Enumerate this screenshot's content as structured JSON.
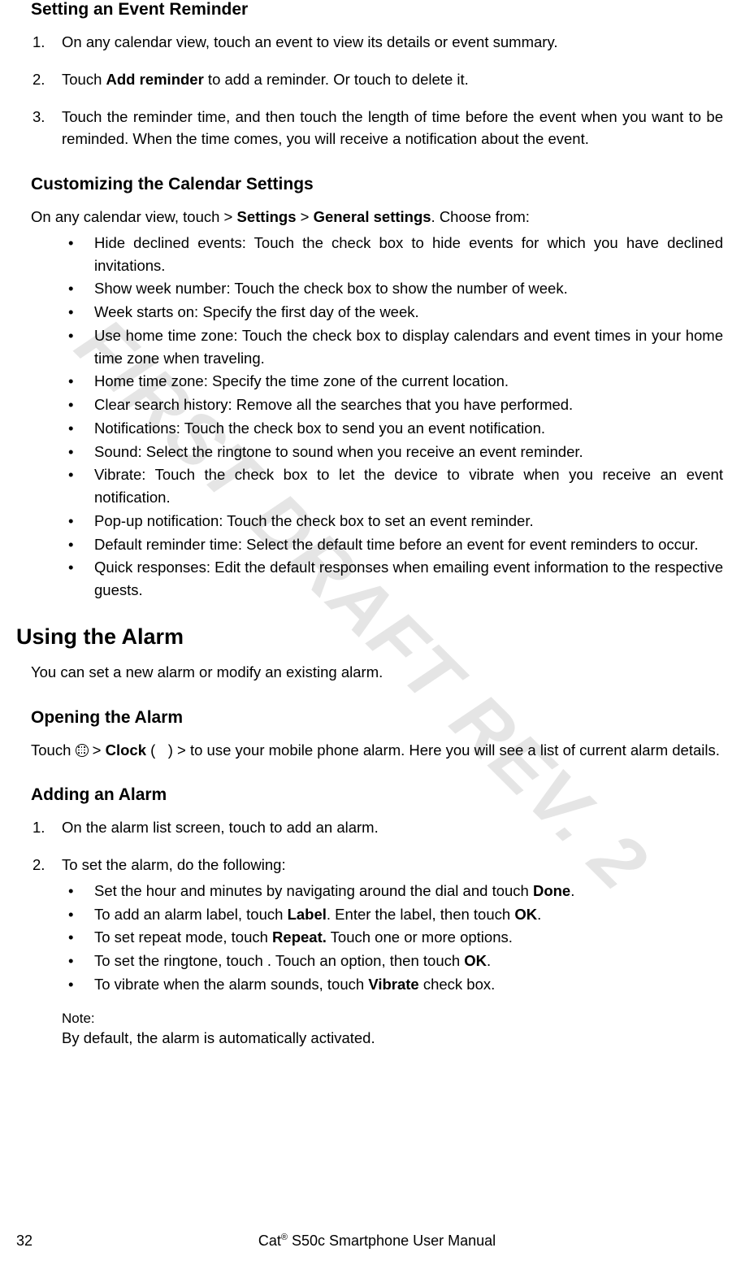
{
  "watermark": "FIRST DRAFT REV. 2",
  "sec1_title": "Setting an Event Reminder",
  "sec1_items": [
    "On any calendar view, touch an event to view its details or event summary.",
    {
      "pre": "Touch ",
      "b1": "Add reminder",
      "post": " to add a reminder. Or touch     to delete it."
    },
    "Touch the reminder time, and then touch the length of time before the event when you want to be reminded. When the time comes, you will receive a notification about the event."
  ],
  "sec2_title": "Customizing the Calendar Settings",
  "sec2_intro": {
    "pre": "On any calendar view, touch     > ",
    "b1": "Settings",
    "mid": " > ",
    "b2": "General settings",
    "post": ". Choose from:"
  },
  "sec2_bullets": [
    "Hide declined events: Touch the check box to hide events for which you have declined invitations.",
    "Show week number: Touch the check box to show the number of week.",
    "Week starts on: Specify the first day of the week.",
    "Use home time zone: Touch the check box to display calendars and event times in your home time zone when traveling.",
    "Home time zone: Specify the time zone of the current location.",
    "Clear search history: Remove all the searches that you have performed.",
    "Notifications: Touch the check box to send you an event notification.",
    "Sound: Select the ringtone to sound when you receive an event reminder.",
    "Vibrate: Touch the check box to let the device to vibrate when you receive an event notification.",
    "Pop-up notification: Touch the check box to set an event reminder.",
    "Default reminder time: Select the default time before an event for event reminders to occur.",
    "Quick responses: Edit the default responses when emailing event information to the respective guests."
  ],
  "heading_alarm": "Using the Alarm",
  "alarm_intro": "You can set a new alarm or modify an existing alarm.",
  "sec3_title": "Opening the Alarm",
  "sec3_body": {
    "pre": "Touch ",
    "mid": " > ",
    "b1": "Clock",
    "paren_open": " (",
    "paren_close": ") > to use your mobile phone alarm. Here you will see a list of current alarm details."
  },
  "sec4_title": "Adding an Alarm",
  "sec4_item1": "On the alarm list screen, touch     to add an alarm.",
  "sec4_item2_lead": "To set the alarm, do the following:",
  "sec4_sub": [
    {
      "pre": "Set the hour and minutes by navigating around the dial and touch ",
      "b": "Done",
      "post": "."
    },
    {
      "pre": "To add an alarm label, touch ",
      "b": "Label",
      "mid": ". Enter the label, then touch ",
      "b2": "OK",
      "post": "."
    },
    {
      "pre": "To set repeat mode, touch ",
      "b": "Repeat.",
      "post": " Touch one or more options."
    },
    {
      "pre": "To set the ringtone, touch    . Touch an option, then touch ",
      "b": "OK",
      "post": "."
    },
    {
      "pre": "To vibrate when the alarm sounds, touch ",
      "b": "Vibrate",
      "post": " check box."
    }
  ],
  "note_label": "Note:",
  "note_body": "By default, the alarm is automatically activated.",
  "page_number": "32",
  "footer_pre": "Cat",
  "footer_sup": "®",
  "footer_post": " S50c Smartphone User Manual"
}
